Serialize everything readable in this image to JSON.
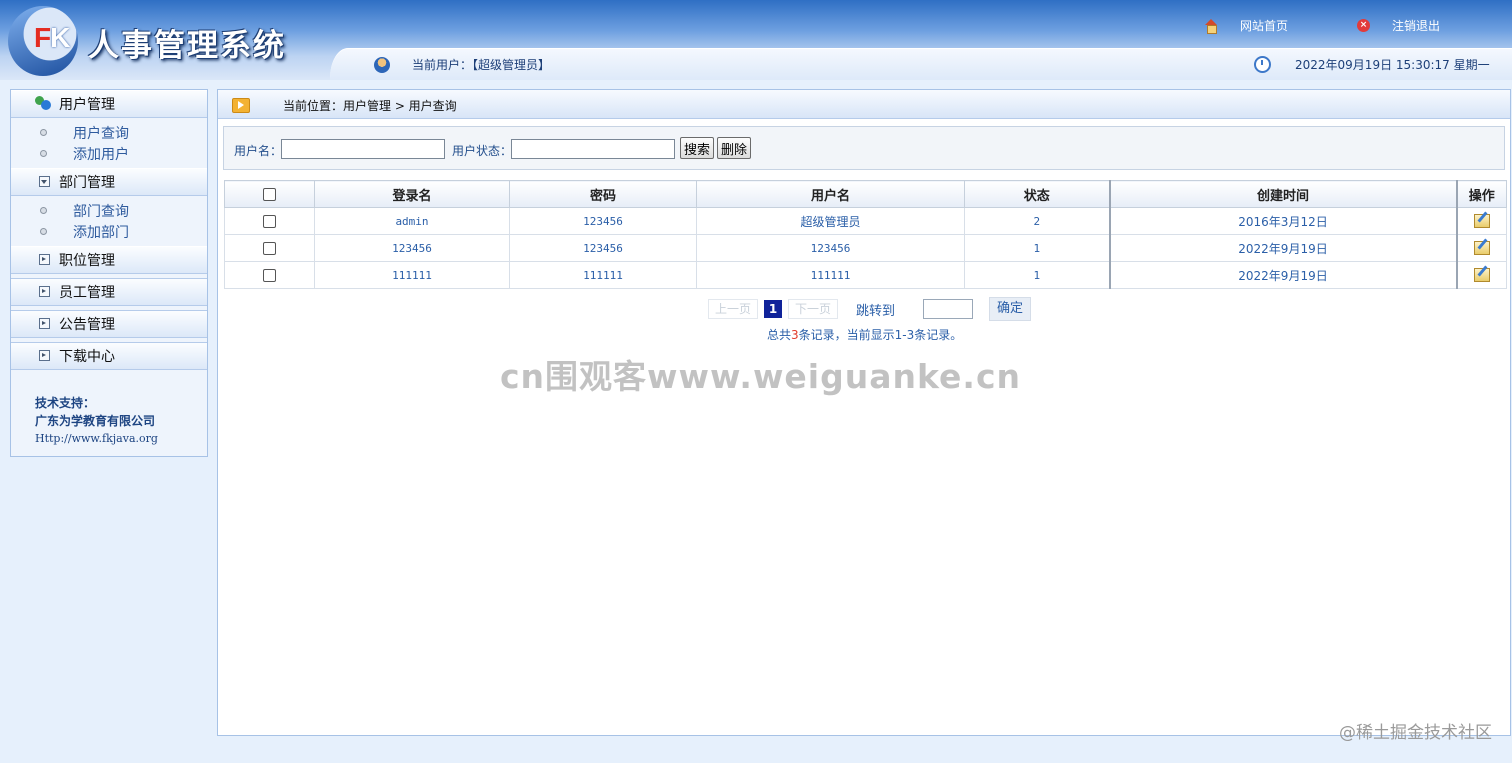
{
  "header": {
    "logo_letters": {
      "f": "F",
      "k": "K"
    },
    "app_title": "人事管理系统",
    "home_link": "网站首页",
    "logout_link": "注销退出",
    "current_user": "当前用户：【超级管理员】",
    "datetime": "2022年09月19日 15:30:17 星期一"
  },
  "sidebar": {
    "groups": [
      {
        "label": "用户管理",
        "items": [
          "用户查询",
          "添加用户"
        ]
      },
      {
        "label": "部门管理",
        "items": [
          "部门查询",
          "添加部门"
        ]
      },
      {
        "label": "职位管理"
      },
      {
        "label": "员工管理"
      },
      {
        "label": "公告管理"
      },
      {
        "label": "下载中心"
      }
    ],
    "support": {
      "title": "技术支持：",
      "company": "广东为学教育有限公司",
      "url": "Http://www.fkjava.org"
    }
  },
  "breadcrumb": "当前位置：用户管理 > 用户查询",
  "search": {
    "username_label": "用户名：",
    "username_value": "",
    "status_label": "用户状态：",
    "status_value": "",
    "search_button": "搜索",
    "delete_button": "删除"
  },
  "table": {
    "headers": [
      "登录名",
      "密码",
      "用户名",
      "状态",
      "创建时间",
      "操作"
    ],
    "rows": [
      {
        "login": "admin",
        "password": "123456",
        "username": "超级管理员",
        "status": "2",
        "created": "2016年3月12日"
      },
      {
        "login": "123456",
        "password": "123456",
        "username": "123456",
        "status": "1",
        "created": "2022年9月19日"
      },
      {
        "login": "111111",
        "password": "111111",
        "username": "111111",
        "status": "1",
        "created": "2022年9月19日"
      }
    ]
  },
  "pager": {
    "prev": "上一页",
    "current": "1",
    "next": "下一页",
    "jump_label": "跳转到",
    "jump_value": "",
    "ok": "确定",
    "summary_prefix": "总共",
    "total": "3",
    "summary_suffix": "条记录，当前显示1-3条记录。"
  },
  "watermark": "cn围观客www.weiguanke.cn",
  "corner_mark": "@稀土掘金技术社区"
}
